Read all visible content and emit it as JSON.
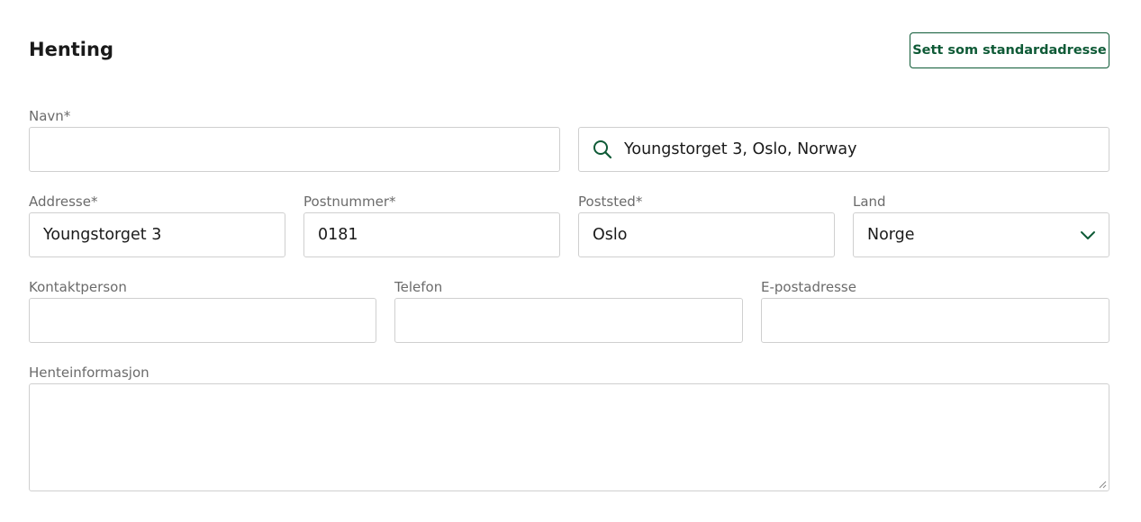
{
  "section": {
    "title": "Henting",
    "default_button_label": "Sett som standardadresse"
  },
  "form": {
    "name": {
      "label": "Navn*",
      "value": ""
    },
    "search": {
      "value": "Youngstorget 3, Oslo, Norway"
    },
    "address": {
      "label": "Addresse*",
      "value": "Youngstorget 3"
    },
    "postal_code": {
      "label": "Postnummer*",
      "value": "0181"
    },
    "city": {
      "label": "Poststed*",
      "value": "Oslo"
    },
    "country": {
      "label": "Land",
      "value": "Norge"
    },
    "contact_person": {
      "label": "Kontaktperson",
      "value": ""
    },
    "phone": {
      "label": "Telefon",
      "value": ""
    },
    "email": {
      "label": "E-postadresse",
      "value": ""
    },
    "pickup_info": {
      "label": "Henteinformasjon",
      "value": ""
    }
  },
  "colors": {
    "accent": "#0e5a36",
    "border": "#cfcfcf",
    "label": "#6b6b6b"
  },
  "icons": {
    "search": "search-icon",
    "country_dropdown": "chevron-down-icon",
    "resize": "resize-grip-icon"
  }
}
